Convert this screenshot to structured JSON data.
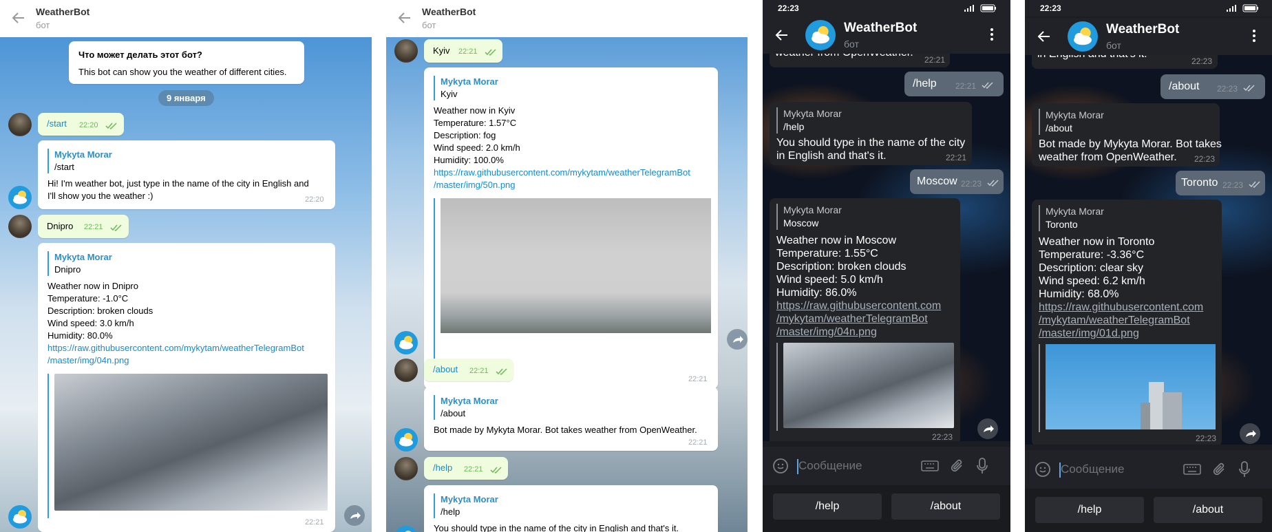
{
  "bot": {
    "title": "WeatherBot",
    "subtitle": "бот"
  },
  "panel1": {
    "intro_title": "Что может делать этот бот?",
    "intro_text": "This bot can show you the weather of different cities.",
    "date_chip": "9 января",
    "msg_start": {
      "text": "/start",
      "time": "22:20"
    },
    "reply_start": {
      "author": "Mykyta Morar",
      "quote": "/start",
      "line1": "Hi! I'm weather bot, just type in the name of the city in English and",
      "line2": "I'll show you the weather :)",
      "time": "22:20"
    },
    "msg_city": {
      "text": "Dnipro",
      "time": "22:21"
    },
    "reply_city": {
      "author": "Mykyta Morar",
      "quote": "Dnipro",
      "lines": [
        "Weather now in Dnipro",
        "Temperature:  -1.0°C",
        "Description: broken clouds",
        "Wind speed: 3.0 km/h",
        "Humidity: 80.0%"
      ],
      "link1": "https://raw.githubusercontent.com/mykytam/weatherTelegramBot",
      "link2": "/master/img/04n.png",
      "time": "22:21"
    }
  },
  "panel2": {
    "msg_city": {
      "text": "Kyiv",
      "time": "22:21"
    },
    "reply_city": {
      "author": "Mykyta Morar",
      "quote": "Kyiv",
      "lines": [
        "Weather now in Kyiv",
        "Temperature:  1.57°C",
        "Description: fog",
        "Wind speed: 2.0 km/h",
        "Humidity: 100.0%"
      ],
      "link1": "https://raw.githubusercontent.com/mykytam/weatherTelegramBot",
      "link2": "/master/img/50n.png",
      "time": "22:21"
    },
    "msg_about": {
      "text": "/about",
      "time": "22:21"
    },
    "reply_about": {
      "author": "Mykyta Morar",
      "quote": "/about",
      "text": "Bot made by Mykyta Morar. Bot takes weather from OpenWeather.",
      "time": "22:21"
    },
    "msg_help": {
      "text": "/help",
      "time": "22:21"
    },
    "reply_help": {
      "author": "Mykyta Morar",
      "quote": "/help",
      "text": "You should type in the name of the city in English and that's it."
    }
  },
  "panel3": {
    "status_time": "22:23",
    "top_fragment": "weather from OpenWeather.",
    "top_fragment_time": "22:21",
    "msg_help": {
      "text": "/help",
      "time": "22:21"
    },
    "reply_help": {
      "author": "Mykyta Morar",
      "quote": "/help",
      "line1": "You should type in the name of the city",
      "line2": "in English and that's it.",
      "time": "22:21"
    },
    "msg_city": {
      "text": "Moscow",
      "time": "22:23"
    },
    "reply_city": {
      "author": "Mykyta Morar",
      "quote": "Moscow",
      "lines": [
        "Weather now in Moscow",
        "Temperature:  1.55°C",
        "Description: broken clouds",
        "Wind speed: 5.0 km/h",
        "Humidity: 86.0%"
      ],
      "links": [
        "https://raw.githubusercontent.com",
        "/mykytam/weatherTelegramBot",
        "/master/img/04n.png"
      ],
      "time": "22:23"
    },
    "input_placeholder": "Сообщение",
    "keys": [
      "/help",
      "/about"
    ]
  },
  "panel4": {
    "status_time": "22:23",
    "top_fragment": "in English and that's it.",
    "top_fragment_time": "22:23",
    "msg_about": {
      "text": "/about",
      "time": "22:23"
    },
    "reply_about": {
      "author": "Mykyta Morar",
      "quote": "/about",
      "line1": "Bot made by Mykyta Morar. Bot takes",
      "line2": "weather from OpenWeather.",
      "time": "22:23"
    },
    "msg_city": {
      "text": "Toronto",
      "time": "22:23"
    },
    "reply_city": {
      "author": "Mykyta Morar",
      "quote": "Toronto",
      "lines": [
        "Weather now in Toronto",
        "Temperature:  -3.36°C",
        "Description: clear sky",
        "Wind speed: 6.2 km/h",
        "Humidity: 68.0%"
      ],
      "links": [
        "https://raw.githubusercontent.com",
        "/mykytam/weatherTelegramBot",
        "/master/img/01d.png"
      ],
      "time": "22:23"
    },
    "input_placeholder": "Сообщение",
    "keys": [
      "/help",
      "/about"
    ]
  }
}
